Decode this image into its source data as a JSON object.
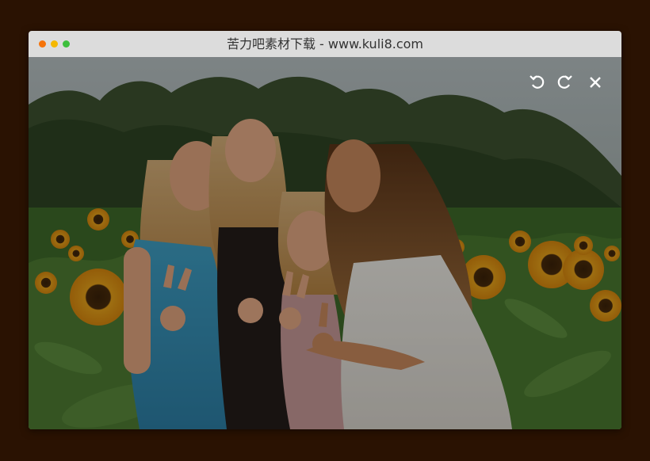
{
  "window": {
    "title": "苦力吧素材下载 - www.kuli8.com",
    "controls": [
      {
        "name": "close",
        "color": "#f5730a"
      },
      {
        "name": "minimize",
        "color": "#f5b800"
      },
      {
        "name": "maximize",
        "color": "#3cbf3c"
      }
    ]
  },
  "viewer": {
    "toolbar": [
      {
        "name": "rotate-left-icon",
        "glyph": "↺"
      },
      {
        "name": "rotate-right-icon",
        "glyph": "↻"
      },
      {
        "name": "close-icon",
        "glyph": "✕"
      }
    ]
  },
  "colors": {
    "page_background": "#2a1202",
    "titlebar": "#dcdcdc",
    "overlay_dim": "rgba(0,0,0,0.35)"
  }
}
